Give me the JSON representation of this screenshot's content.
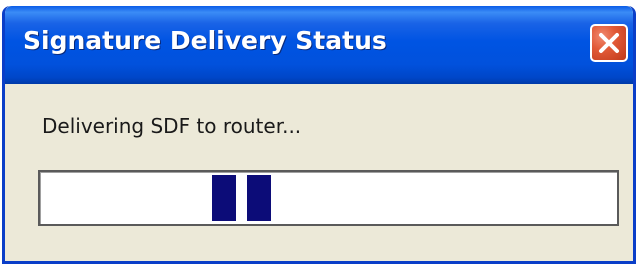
{
  "window": {
    "title": "Signature Delivery Status",
    "close_icon": "close-icon"
  },
  "body": {
    "status_text": "Delivering SDF to router..."
  },
  "progress": {
    "style": "marquee",
    "chunk_count": 2,
    "chunk_color": "#0c0c78"
  },
  "colors": {
    "titlebar": "#0054e3",
    "close_button": "#e25a37",
    "window_background": "#ece9d8"
  }
}
